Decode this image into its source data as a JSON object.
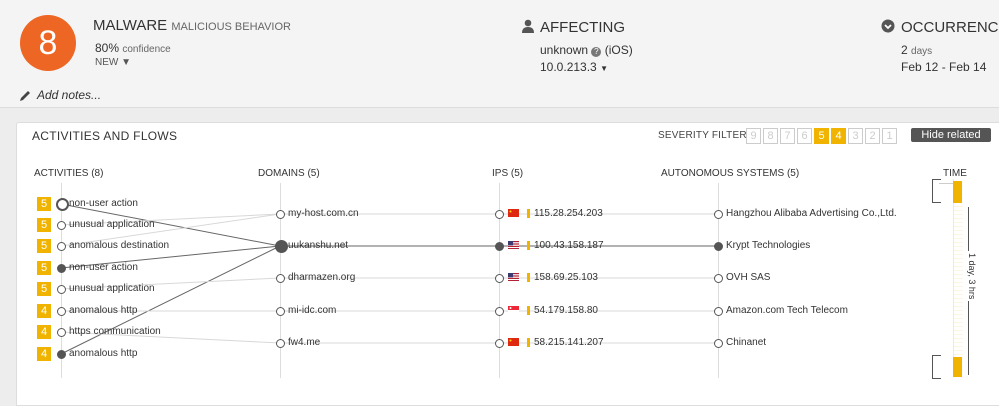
{
  "header": {
    "score": "8",
    "category": "MALWARE",
    "subcategory": "MALICIOUS BEHAVIOR",
    "confidence_value": "80%",
    "confidence_label": "confidence",
    "status": "NEW",
    "affecting_title": "AFFECTING",
    "affecting_user": "unknown",
    "affecting_os": "(iOS)",
    "affecting_ip": "10.0.213.3",
    "occurrence_title": "OCCURRENCE",
    "occurrence_count": "2",
    "occurrence_unit": "days",
    "occurrence_range": "Feb 12 - Feb 14",
    "notes_placeholder": "Add notes..."
  },
  "panel": {
    "title": "ACTIVITIES AND FLOWS",
    "severity_label": "SEVERITY FILTER:",
    "severity_levels": [
      "9",
      "8",
      "7",
      "6",
      "5",
      "4",
      "3",
      "2",
      "1"
    ],
    "severity_active": [
      "5",
      "4"
    ],
    "hide_button": "Hide related",
    "columns": {
      "activities": "ACTIVITIES (8)",
      "domains": "DOMAINS (5)",
      "ips": "IPS (5)",
      "asn": "AUTONOMOUS SYSTEMS (5)",
      "time": "TIME"
    },
    "activities": [
      {
        "severity": "5",
        "label": "non-user action"
      },
      {
        "severity": "5",
        "label": "unusual application"
      },
      {
        "severity": "5",
        "label": "anomalous destination"
      },
      {
        "severity": "5",
        "label": "non-user action"
      },
      {
        "severity": "5",
        "label": "unusual application"
      },
      {
        "severity": "4",
        "label": "anomalous http"
      },
      {
        "severity": "4",
        "label": "https communication"
      },
      {
        "severity": "4",
        "label": "anomalous http"
      }
    ],
    "domains": [
      "my-host.com.cn",
      "uukanshu.net",
      "dharmazen.org",
      "mi-idc.com",
      "fw4.me"
    ],
    "ips": [
      {
        "ip": "115.28.254.203",
        "flag": "cn"
      },
      {
        "ip": "100.43.158.187",
        "flag": "us"
      },
      {
        "ip": "158.69.25.103",
        "flag": "us"
      },
      {
        "ip": "54.179.158.80",
        "flag": "sg"
      },
      {
        "ip": "58.215.141.207",
        "flag": "cn"
      }
    ],
    "asns": [
      "Hangzhou Alibaba Advertising Co.,Ltd.",
      "Krypt Technologies",
      "OVH SAS",
      "Amazon.com Tech Telecom",
      "Chinanet"
    ],
    "time_span": "1 day, 3 hrs"
  },
  "colors": {
    "score": "#ee6623",
    "severity": "#f0b400",
    "button": "#555555"
  }
}
